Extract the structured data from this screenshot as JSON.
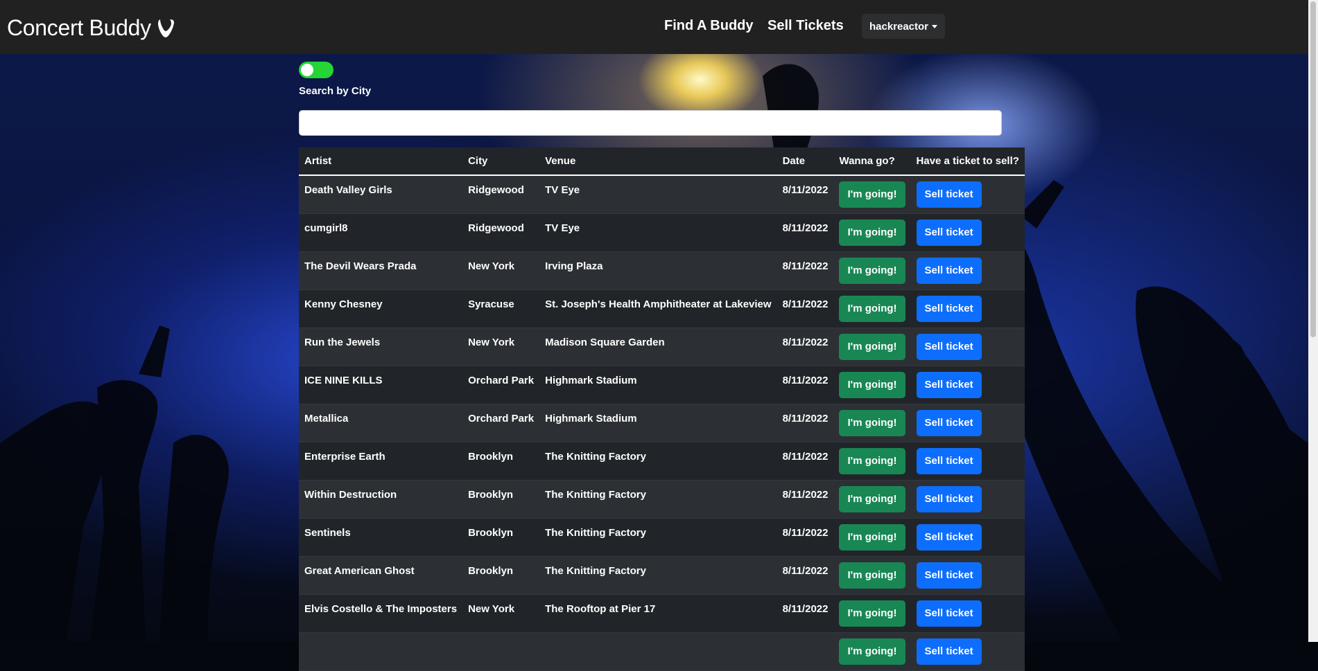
{
  "navbar": {
    "brand": "Concert Buddy",
    "brand_icon": "typo3-logo-icon",
    "links": [
      "Find A Buddy",
      "Sell Tickets"
    ],
    "user": "hackreactor"
  },
  "filter": {
    "toggle_on": true,
    "toggle_label": "Search by City",
    "search_value": "",
    "search_placeholder": ""
  },
  "table": {
    "headers": [
      "Artist",
      "City",
      "Venue",
      "Date",
      "Wanna go?",
      "Have a ticket to sell?"
    ],
    "going_label": "I'm going!",
    "sell_label": "Sell ticket",
    "rows": [
      {
        "artist": "Death Valley Girls",
        "city": "Ridgewood",
        "venue": "TV Eye",
        "date": "8/11/2022"
      },
      {
        "artist": "cumgirl8",
        "city": "Ridgewood",
        "venue": "TV Eye",
        "date": "8/11/2022"
      },
      {
        "artist": "The Devil Wears Prada",
        "city": "New York",
        "venue": "Irving Plaza",
        "date": "8/11/2022"
      },
      {
        "artist": "Kenny Chesney",
        "city": "Syracuse",
        "venue": "St. Joseph's Health Amphitheater at Lakeview",
        "date": "8/11/2022"
      },
      {
        "artist": "Run the Jewels",
        "city": "New York",
        "venue": "Madison Square Garden",
        "date": "8/11/2022"
      },
      {
        "artist": "ICE NINE KILLS",
        "city": "Orchard Park",
        "venue": "Highmark Stadium",
        "date": "8/11/2022"
      },
      {
        "artist": "Metallica",
        "city": "Orchard Park",
        "venue": "Highmark Stadium",
        "date": "8/11/2022"
      },
      {
        "artist": "Enterprise Earth",
        "city": "Brooklyn",
        "venue": "The Knitting Factory",
        "date": "8/11/2022"
      },
      {
        "artist": "Within Destruction",
        "city": "Brooklyn",
        "venue": "The Knitting Factory",
        "date": "8/11/2022"
      },
      {
        "artist": "Sentinels",
        "city": "Brooklyn",
        "venue": "The Knitting Factory",
        "date": "8/11/2022"
      },
      {
        "artist": "Great American Ghost",
        "city": "Brooklyn",
        "venue": "The Knitting Factory",
        "date": "8/11/2022"
      },
      {
        "artist": "Elvis Costello & The Imposters",
        "city": "New York",
        "venue": "The Rooftop at Pier 17",
        "date": "8/11/2022"
      },
      {
        "artist": "",
        "city": "",
        "venue": "",
        "date": ""
      }
    ]
  },
  "colors": {
    "navbar_bg": "#212121",
    "toggle_on": "#24d535",
    "going_button": "#198754",
    "sell_button": "#0d6efd",
    "table_row_dark": "#212529",
    "table_row_light": "#2c3034"
  }
}
